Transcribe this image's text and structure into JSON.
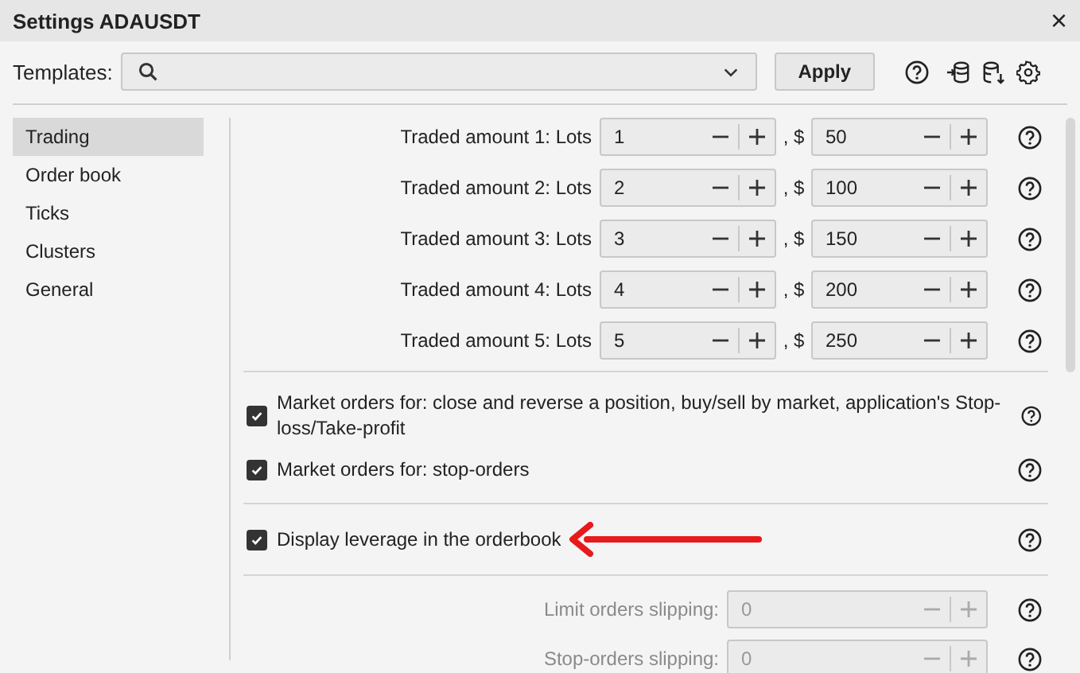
{
  "window": {
    "title": "Settings ADAUSDT",
    "close": "×"
  },
  "toolbar": {
    "label": "Templates:",
    "apply": "Apply"
  },
  "sidebar": {
    "items": [
      {
        "label": "Trading",
        "selected": true
      },
      {
        "label": "Order book",
        "selected": false
      },
      {
        "label": "Ticks",
        "selected": false
      },
      {
        "label": "Clusters",
        "selected": false
      },
      {
        "label": "General",
        "selected": false
      }
    ]
  },
  "amounts": [
    {
      "label": "Traded amount 1: Lots",
      "lots": "1",
      "separator": ", $",
      "usd": "50"
    },
    {
      "label": "Traded amount 2: Lots",
      "lots": "2",
      "separator": ", $",
      "usd": "100"
    },
    {
      "label": "Traded amount 3: Lots",
      "lots": "3",
      "separator": ", $",
      "usd": "150"
    },
    {
      "label": "Traded amount 4: Lots",
      "lots": "4",
      "separator": ", $",
      "usd": "200"
    },
    {
      "label": "Traded amount 5: Lots",
      "lots": "5",
      "separator": ", $",
      "usd": "250"
    }
  ],
  "option_groups": [
    [
      {
        "label": "Market orders for: close and reverse a position, buy/sell by market, application's Stop-loss/Take-profit",
        "checked": true
      },
      {
        "label": "Market orders for: stop-orders",
        "checked": true
      }
    ],
    [
      {
        "label": "Display leverage in the orderbook",
        "checked": true,
        "annotated": true
      }
    ]
  ],
  "slipping": [
    {
      "label": "Limit orders slipping:",
      "value": "0",
      "disabled": true
    },
    {
      "label": "Stop-orders slipping:",
      "value": "0",
      "disabled": true
    }
  ]
}
